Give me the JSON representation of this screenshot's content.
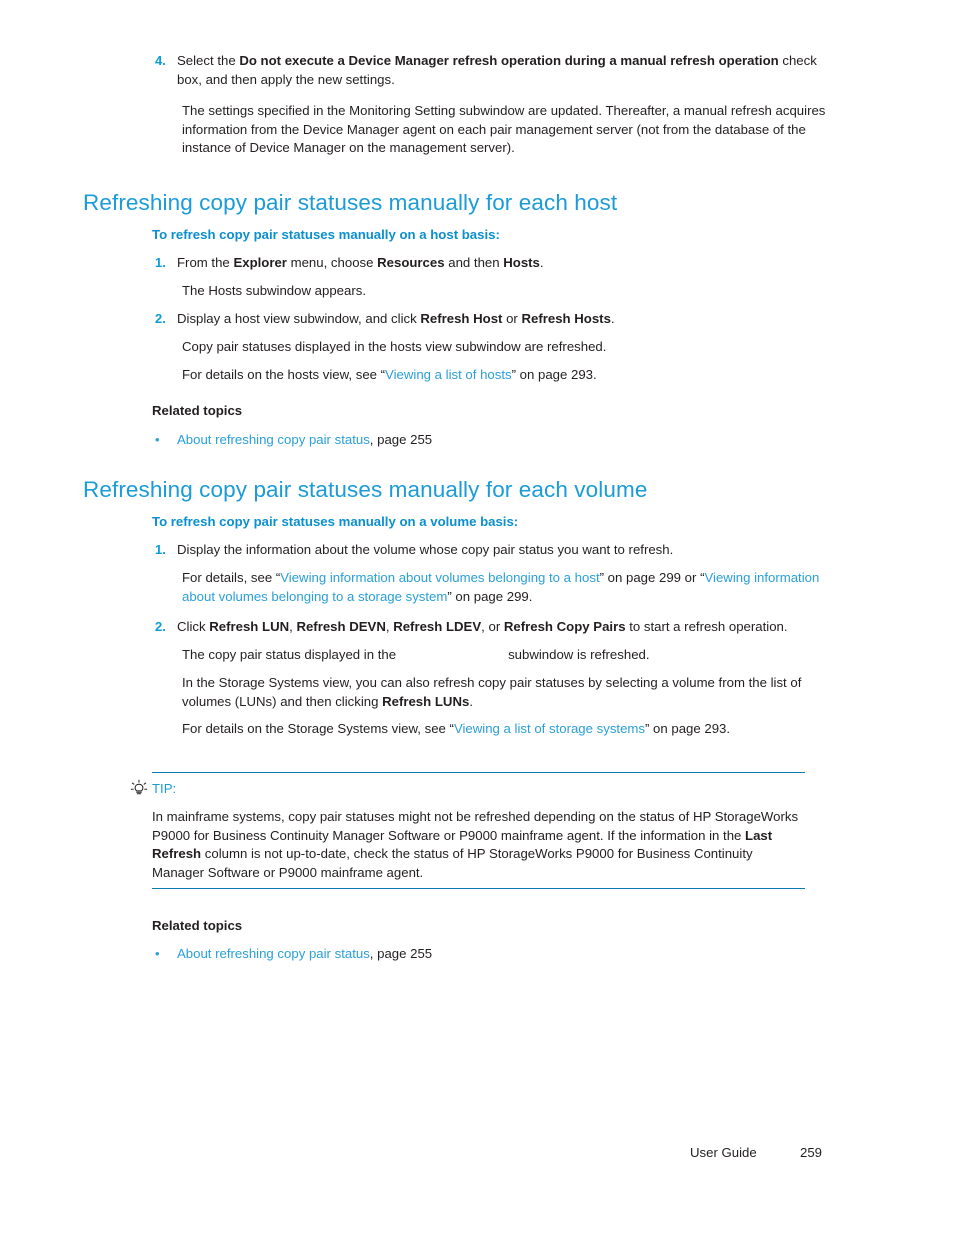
{
  "document": {
    "footer_label": "User Guide",
    "page_number": "259",
    "accent_blue": "#1b9bd8",
    "heading_blue": "#0b8fcf",
    "link_blue": "#2f9ed4",
    "rule_blue": "#0c7cb0",
    "text_color": "#231f20"
  },
  "step4": {
    "number": "4.",
    "line1_a": "Select the ",
    "line1_bold": "Do not execute a Device Manager refresh operation during a manual refresh operation",
    "line1_b": " check box, and then apply the new settings.",
    "paragraph": "The settings specified in the Monitoring Setting subwindow are updated. Thereafter, a manual refresh acquires information from the Device Manager agent on each pair management server (not from the database of the instance of Device Manager on the management server)."
  },
  "section_host": {
    "heading": "Refreshing copy pair statuses manually for each host",
    "subheading": "To refresh copy pair statuses manually on a host basis:",
    "step1": {
      "number": "1.",
      "a": "From the ",
      "b1": "Explorer",
      "c": " menu, choose ",
      "b2": "Resources",
      "d": " and then ",
      "b3": "Hosts",
      "e": ".",
      "result": "The Hosts subwindow appears."
    },
    "step2": {
      "number": "2.",
      "a": "Display a host view subwindow, and click ",
      "b1": "Refresh Host",
      "c": " or ",
      "b2": "Refresh Hosts",
      "d": ".",
      "result": "Copy pair statuses displayed in the hosts view subwindow are refreshed.",
      "detail_a": "For details on the hosts view, see “",
      "detail_link": "Viewing a list of hosts",
      "detail_b": "” on page 293."
    },
    "related_title": "Related topics",
    "related_items": [
      {
        "link": "About refreshing copy pair status",
        "suffix": ", page 255"
      }
    ]
  },
  "section_volume": {
    "heading": "Refreshing copy pair statuses manually for each volume",
    "subheading": "To refresh copy pair statuses manually on a volume basis:",
    "step1": {
      "number": "1.",
      "text": "Display the information about the volume whose copy pair status you want to refresh.",
      "detail_a": "For details, see “",
      "detail_link1": "Viewing information about volumes belonging to a host",
      "detail_b": "” on page 299 or “",
      "detail_link2": "Viewing information about volumes belonging to a storage system",
      "detail_c": "” on page 299."
    },
    "step2": {
      "number": "2.",
      "a": "Click ",
      "b1": "Refresh LUN",
      "c1": ", ",
      "b2": "Refresh DEVN",
      "c2": ", ",
      "b3": "Refresh LDEV",
      "c3": ", or ",
      "b4": "Refresh Copy Pairs",
      "c4": " to start a refresh operation.",
      "result_a": "The copy pair status displayed in the",
      "result_b": "subwindow is refreshed.",
      "storage_a": "In the Storage Systems view, you can also refresh copy pair statuses by selecting a volume from the list of volumes (LUNs) and then clicking ",
      "storage_bold": "Refresh LUNs",
      "storage_b": ".",
      "detail_a": "For details on the Storage Systems view, see “",
      "detail_link": "Viewing a list of storage systems",
      "detail_b": "” on page 293."
    },
    "related_title": "Related topics",
    "related_items": [
      {
        "link": "About refreshing copy pair status",
        "suffix": ", page 255"
      }
    ]
  },
  "tip": {
    "icon": "lightbulb-icon",
    "label": "TIP:",
    "body_a": "In mainframe systems, copy pair statuses might not be refreshed depending on the status of HP StorageWorks P9000 for Business Continuity Manager Software or P9000 mainframe agent. If the information in the ",
    "body_bold": "Last Refresh",
    "body_b": " column is not up-to-date, check the status of HP StorageWorks P9000 for Business Continuity Manager Software or P9000 mainframe agent."
  }
}
